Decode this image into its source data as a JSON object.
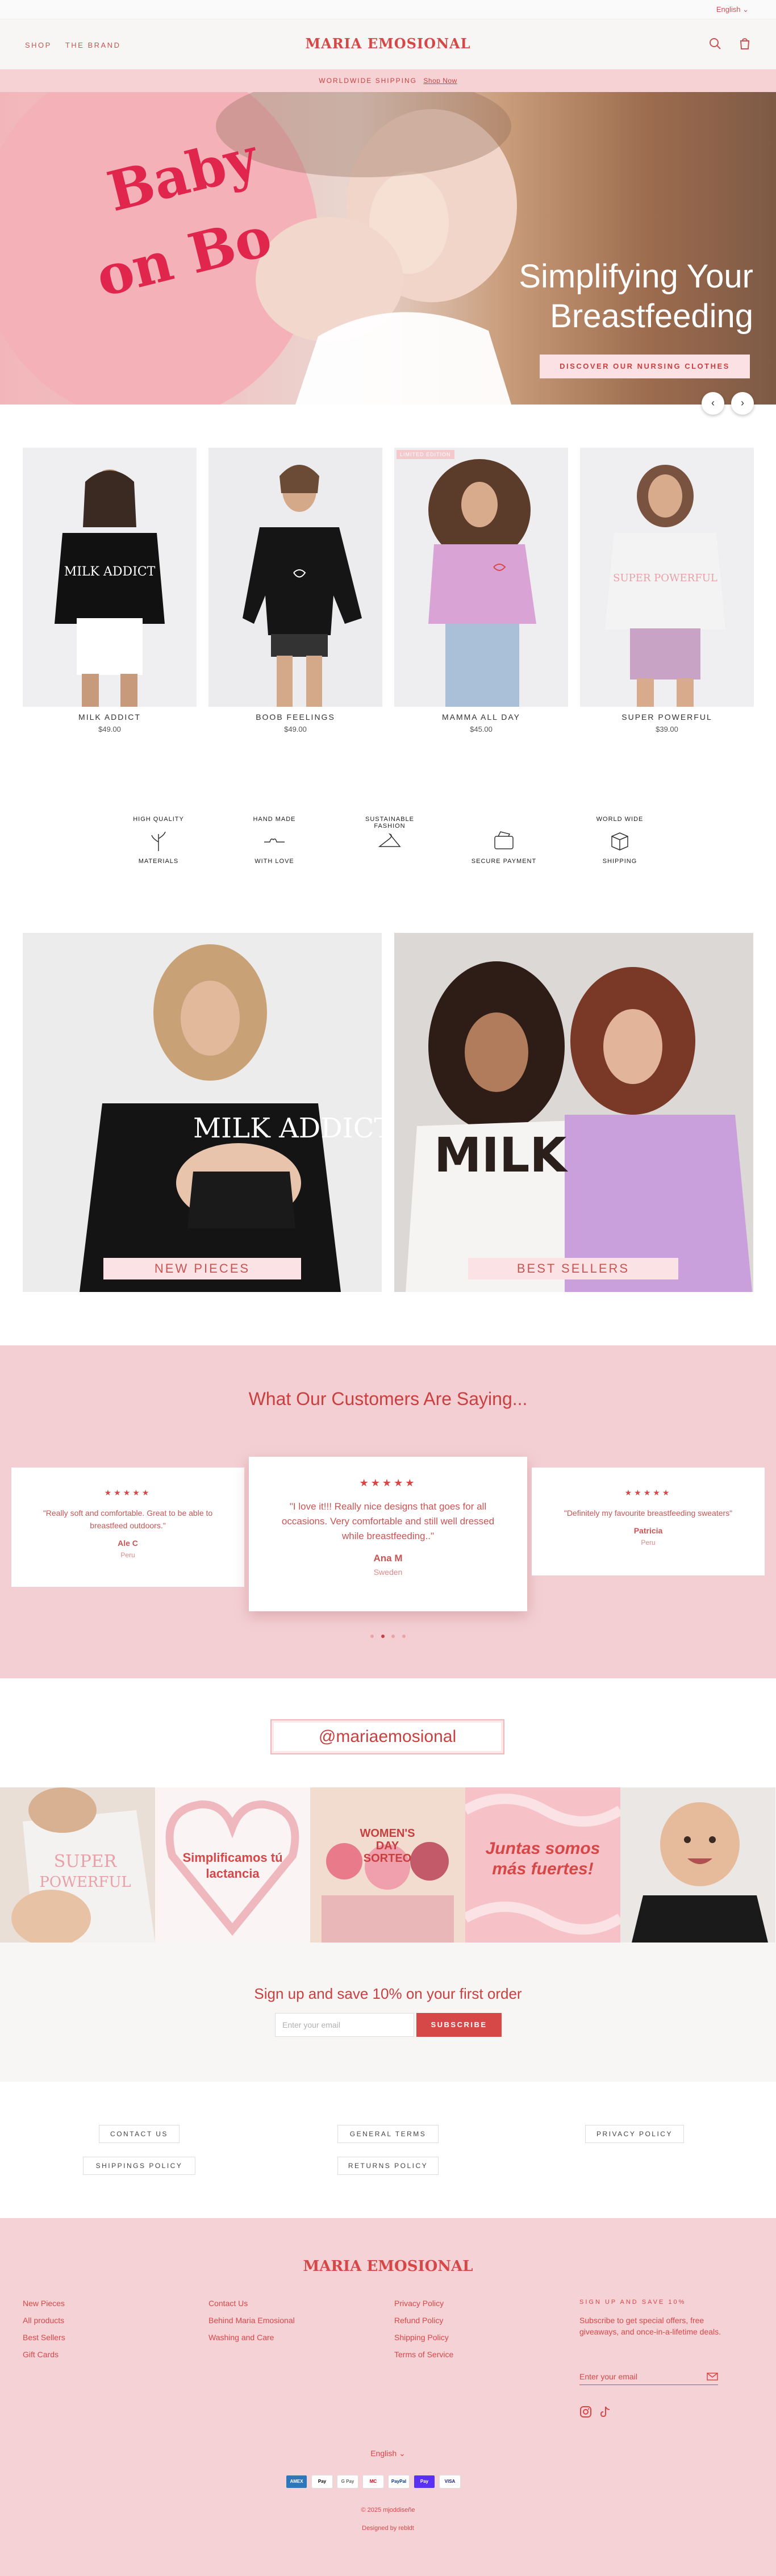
{
  "top_bar": {
    "language": "English"
  },
  "header": {
    "nav": [
      "SHOP",
      "THE BRAND"
    ],
    "logo": "MARIA EMOSIONAL"
  },
  "announcement": {
    "text": "WORLDWIDE SHIPPING",
    "link": "Shop Now"
  },
  "hero": {
    "title_line1": "Simplifying Your",
    "title_line2": "Breastfeeding",
    "shirt_text_line1": "Baby",
    "shirt_text_line2": "on Bo",
    "cta": "DISCOVER OUR NURSING CLOTHES"
  },
  "products": [
    {
      "name": "MILK ADDICT",
      "price": "$49.00",
      "shirt_text": "MILK ADDICT",
      "shirt_color": "#111111"
    },
    {
      "name": "BOOB FEELINGS",
      "price": "$49.00",
      "shirt_text": "",
      "shirt_color": "#151515"
    },
    {
      "name": "MAMMA ALL DAY",
      "price": "$45.00",
      "shirt_text": "",
      "shirt_color": "#d9a3d6",
      "badge": "LIMITED EDITION"
    },
    {
      "name": "SUPER POWERFUL",
      "price": "$39.00",
      "shirt_text": "SUPER POWERFUL",
      "shirt_color": "#f3f3f3"
    }
  ],
  "features": [
    {
      "top": "HIGH QUALITY",
      "bottom": "MATERIALS",
      "icon": "leaf-icon"
    },
    {
      "top": "HAND MADE",
      "bottom": "WITH LOVE",
      "icon": "heart-line-icon"
    },
    {
      "top": "SUSTAINABLE FASHION",
      "bottom": "",
      "icon": "hanger-icon"
    },
    {
      "top": "",
      "bottom": "SECURE PAYMENT",
      "icon": "payment-icon"
    },
    {
      "top": "WORLD WIDE",
      "bottom": "SHIPPING",
      "icon": "box-icon"
    }
  ],
  "collections": [
    {
      "label": "NEW PIECES",
      "shirt_text": "MILK ADDICT"
    },
    {
      "label": "BEST SELLERS",
      "shirt_text": "MILK"
    }
  ],
  "testimonials": {
    "heading": "What Our Customers Are Saying...",
    "items": [
      {
        "stars": "★★★★★",
        "quote": "\"Really soft and comfortable. Great to be able to breastfeed outdoors.\"",
        "name": "Ale C",
        "place": "Peru"
      },
      {
        "stars": "★★★★★",
        "quote": "\"I love it!!! Really nice designs that goes for all occasions. Very comfortable and still well dressed while breastfeeding..\"",
        "name": "Ana M",
        "place": "Sweden"
      },
      {
        "stars": "★★★★★",
        "quote": "\"Definitely my favourite breastfeeding sweaters\"",
        "name": "Patricia",
        "place": "Peru"
      }
    ]
  },
  "instagram": {
    "handle": "@mariaemosional",
    "tile2_text": "Simplificamos tú lactancia",
    "tile3_text": "WOMEN'S DAY SORTEO",
    "tile4_text": "Juntas somos más fuertes!"
  },
  "newsletter": {
    "heading": "Sign up and save 10% on your first order",
    "placeholder": "Enter your email",
    "button": "SUBSCRIBE"
  },
  "policies": [
    "CONTACT US",
    "GENERAL TERMS",
    "PRIVACY POLICY",
    "SHIPPINGS POLICY",
    "RETURNS POLICY"
  ],
  "footer": {
    "logo": "MARIA EMOSIONAL",
    "col1": [
      "New Pieces",
      "All products",
      "Best Sellers",
      "Gift Cards"
    ],
    "col2": [
      "Contact Us",
      "Behind Maria Emosional",
      "Washing and Care"
    ],
    "col3": [
      "Privacy Policy",
      "Refund Policy",
      "Shipping Policy",
      "Terms of Service"
    ],
    "newsletter_heading": "SIGN UP AND SAVE 10%",
    "newsletter_text": "Subscribe to get special offers, free giveaways, and once-in-a-lifetime deals.",
    "email_placeholder": "Enter your email",
    "language": "English",
    "payments": [
      "AMEX",
      "Pay",
      "G Pay",
      "MC",
      "PayPal",
      "Pay",
      "VISA"
    ],
    "copyright": "© 2025 mjoddiseñe",
    "credit": "Designed by rebldt"
  },
  "colors": {
    "brand": "#d64848",
    "pink_bg": "#f3cfd3",
    "light_pink": "#f7d2d5",
    "cream": "#f8f6f4"
  }
}
